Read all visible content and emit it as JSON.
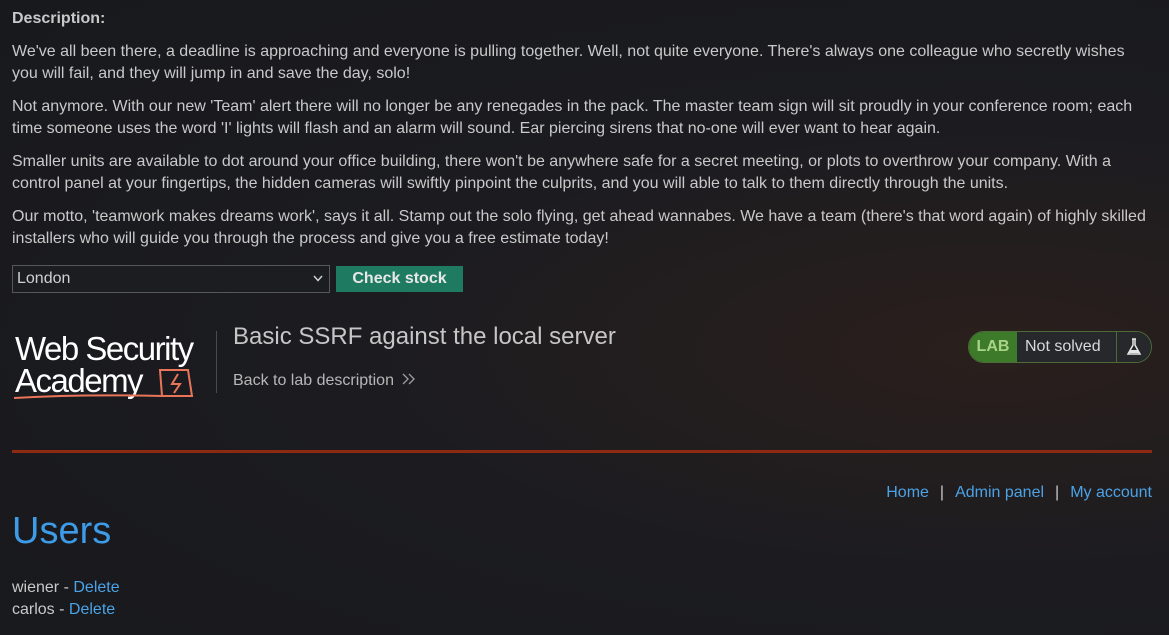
{
  "description": {
    "label": "Description:",
    "paragraphs": [
      "We've all been there, a deadline is approaching and everyone is pulling together. Well, not quite everyone. There's always one colleague who secretly wishes you will fail, and they will jump in and save the day, solo!",
      "Not anymore. With our new 'Team' alert there will no longer be any renegades in the pack. The master team sign will sit proudly in your conference room; each time someone uses the word 'I' lights will flash and an alarm will sound. Ear piercing sirens that no-one will ever want to hear again.",
      "Smaller units are available to dot around your office building, there won't be anywhere safe for a secret meeting, or plots to overthrow your company. With a control panel at your fingertips, the hidden cameras will swiftly pinpoint the culprits, and you will able to talk to them directly through the units.",
      "Our motto, 'teamwork makes dreams work', says it all. Stamp out the solo flying, get ahead wannabes. We have a team (there's that word again) of highly skilled installers who will guide you through the process and give you a free estimate today!"
    ]
  },
  "stock": {
    "selected": "London",
    "button_label": "Check stock"
  },
  "header": {
    "logo_line1": "Web Security",
    "logo_line2": "Academy",
    "lab_title": "Basic SSRF against the local server",
    "back_link": "Back to lab description",
    "status_badge": "LAB",
    "status_text": "Not solved"
  },
  "nav": {
    "home": "Home",
    "admin": "Admin panel",
    "account": "My account",
    "separator": "|"
  },
  "page": {
    "title": "Users"
  },
  "users": [
    {
      "name": "wiener",
      "sep": " - ",
      "action": "Delete"
    },
    {
      "name": "carlos",
      "sep": " - ",
      "action": "Delete"
    }
  ],
  "colors": {
    "accent_link": "#4aa3e6",
    "button_green": "#1f7a62",
    "divider_red": "#8f2a12",
    "lab_badge_green": "#3d7a2a"
  }
}
